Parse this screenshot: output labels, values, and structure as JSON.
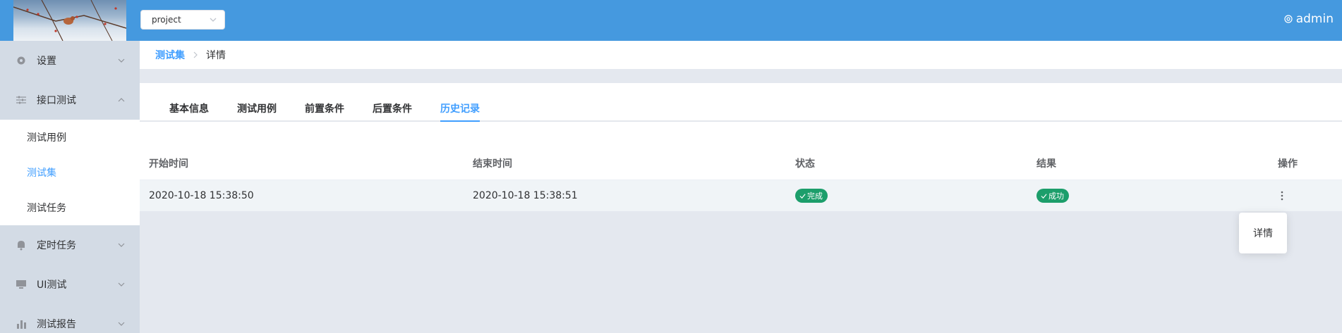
{
  "header": {
    "project_select": {
      "value": "project"
    },
    "user": {
      "name": "admin"
    }
  },
  "sidebar": {
    "items": [
      {
        "label": "设置",
        "icon": "gear-icon",
        "expanded": false
      },
      {
        "label": "接口测试",
        "icon": "sliders-icon",
        "expanded": true,
        "children": [
          {
            "label": "测试用例",
            "active": false
          },
          {
            "label": "测试集",
            "active": true
          },
          {
            "label": "测试任务",
            "active": false
          }
        ]
      },
      {
        "label": "定时任务",
        "icon": "bell-icon",
        "expanded": false
      },
      {
        "label": "UI测试",
        "icon": "monitor-icon",
        "expanded": false
      },
      {
        "label": "测试报告",
        "icon": "bar-chart-icon",
        "expanded": false
      }
    ]
  },
  "breadcrumb": {
    "link": "测试集",
    "current": "详情"
  },
  "tabs": [
    "基本信息",
    "测试用例",
    "前置条件",
    "后置条件",
    "历史记录"
  ],
  "active_tab": "历史记录",
  "table": {
    "columns": [
      "开始时间",
      "结束时间",
      "状态",
      "结果",
      "操作"
    ],
    "rows": [
      {
        "start": "2020-10-18 15:38:50",
        "end": "2020-10-18 15:38:51",
        "status": "完成",
        "result": "成功"
      }
    ]
  },
  "dropdown": {
    "option": "详情"
  },
  "colors": {
    "header": "#4599df",
    "accent": "#409eff",
    "success_tag": "#1c9e6b",
    "sidebar": "#d3dbe5"
  }
}
